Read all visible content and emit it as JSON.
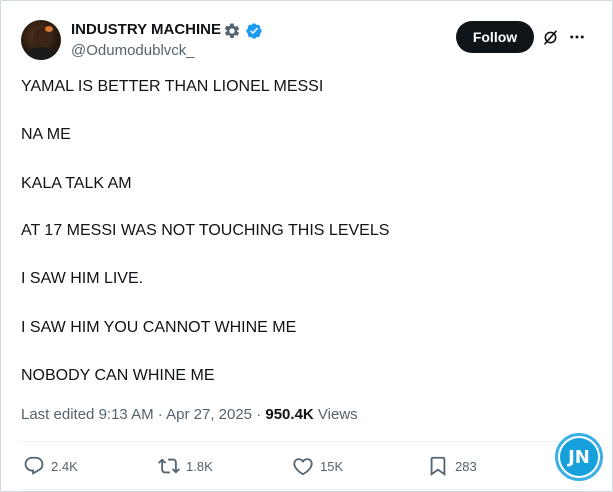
{
  "author": {
    "display_name": "INDUSTRY MACHINE",
    "handle": "@Odumodublvck_",
    "follow_label": "Follow"
  },
  "tweet": {
    "lines": [
      "YAMAL IS BETTER THAN LIONEL MESSI",
      "NA ME",
      "KALA TALK AM",
      "AT 17 MESSI WAS NOT TOUCHING THIS LEVELS",
      "I SAW HIM LIVE.",
      "I SAW HIM YOU CANNOT WHINE ME",
      "NOBODY CAN WHINE ME"
    ]
  },
  "meta": {
    "edited_prefix": "Last edited ",
    "time": "9:13 AM",
    "separator": " · ",
    "date": "Apr 27, 2025",
    "views_count": "950.4K",
    "views_label": " Views"
  },
  "actions": {
    "replies": "2.4K",
    "reposts": "1.8K",
    "likes": "15K",
    "bookmarks": "283"
  },
  "icons": {
    "verified": "verified-badge-icon",
    "affiliate": "gear-icon",
    "grok": "grok-icon",
    "more": "more-icon",
    "reply": "reply-icon",
    "repost": "repost-icon",
    "like": "heart-icon",
    "bookmark": "bookmark-icon"
  },
  "colors": {
    "verified_blue": "#1d9bf0",
    "text_primary": "#0f1419",
    "text_secondary": "#536471",
    "follow_bg": "#0f1419"
  },
  "watermark": {
    "text": "JN"
  }
}
